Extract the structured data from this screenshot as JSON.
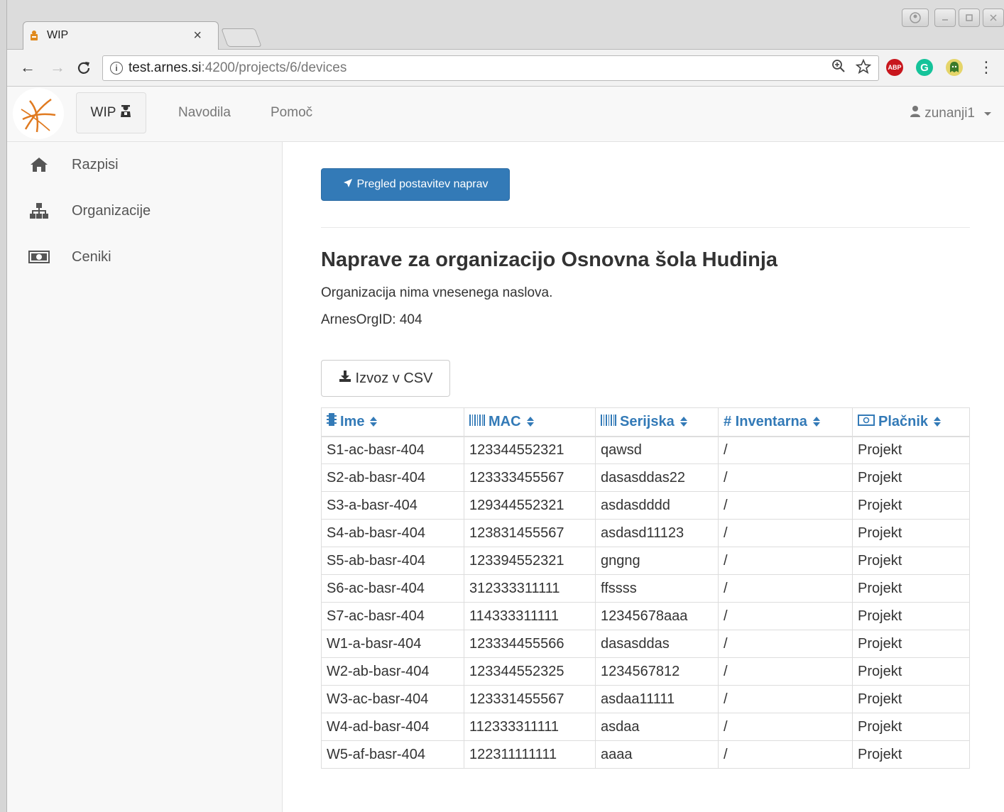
{
  "browser": {
    "tab_title": "WIP",
    "url_host": "test.arnes.si",
    "url_path": ":4200/projects/6/devices",
    "ext_abp": "ABP"
  },
  "navbar": {
    "brand_label": "WIP",
    "links": [
      "Navodila",
      "Pomoč"
    ],
    "user_label": "zunanji1"
  },
  "sidebar": {
    "items": [
      {
        "label": "Razpisi",
        "icon": "home-icon"
      },
      {
        "label": "Organizacije",
        "icon": "sitemap-icon"
      },
      {
        "label": "Ceniki",
        "icon": "money-icon"
      }
    ]
  },
  "main": {
    "overview_button": "Pregled postavitev naprav",
    "title": "Naprave za organizacijo Osnovna šola Hudinja",
    "address_note": "Organizacija nima vnesenega naslova.",
    "org_id": "ArnesOrgID: 404",
    "export_button": "Izvoz v CSV"
  },
  "table": {
    "headers": [
      "Ime",
      "MAC",
      "Serijska",
      "# Inventarna",
      "Plačnik"
    ],
    "rows": [
      [
        "S1-ac-basr-404",
        "123344552321",
        "qawsd",
        "/",
        "Projekt"
      ],
      [
        "S2-ab-basr-404",
        "123333455567",
        "dasasddas22",
        "/",
        "Projekt"
      ],
      [
        "S3-a-basr-404",
        "129344552321",
        "asdasdddd",
        "/",
        "Projekt"
      ],
      [
        "S4-ab-basr-404",
        "123831455567",
        "asdasd11123",
        "/",
        "Projekt"
      ],
      [
        "S5-ab-basr-404",
        "123394552321",
        "gngng",
        "/",
        "Projekt"
      ],
      [
        "S6-ac-basr-404",
        "312333311111",
        "ffssss",
        "/",
        "Projekt"
      ],
      [
        "S7-ac-basr-404",
        "114333311111",
        "12345678aaa",
        "/",
        "Projekt"
      ],
      [
        "W1-a-basr-404",
        "123334455566",
        "dasasddas",
        "/",
        "Projekt"
      ],
      [
        "W2-ab-basr-404",
        "123344552325",
        "1234567812",
        "/",
        "Projekt"
      ],
      [
        "W3-ac-basr-404",
        "123331455567",
        "asdaa11111",
        "/",
        "Projekt"
      ],
      [
        "W4-ad-basr-404",
        "112333311111",
        "asdaa",
        "/",
        "Projekt"
      ],
      [
        "W5-af-basr-404",
        "122311111111",
        "aaaa",
        "/",
        "Projekt"
      ]
    ]
  },
  "colors": {
    "primary": "#337ab7",
    "navbar_bg": "#f8f8f8",
    "text": "#333333"
  }
}
